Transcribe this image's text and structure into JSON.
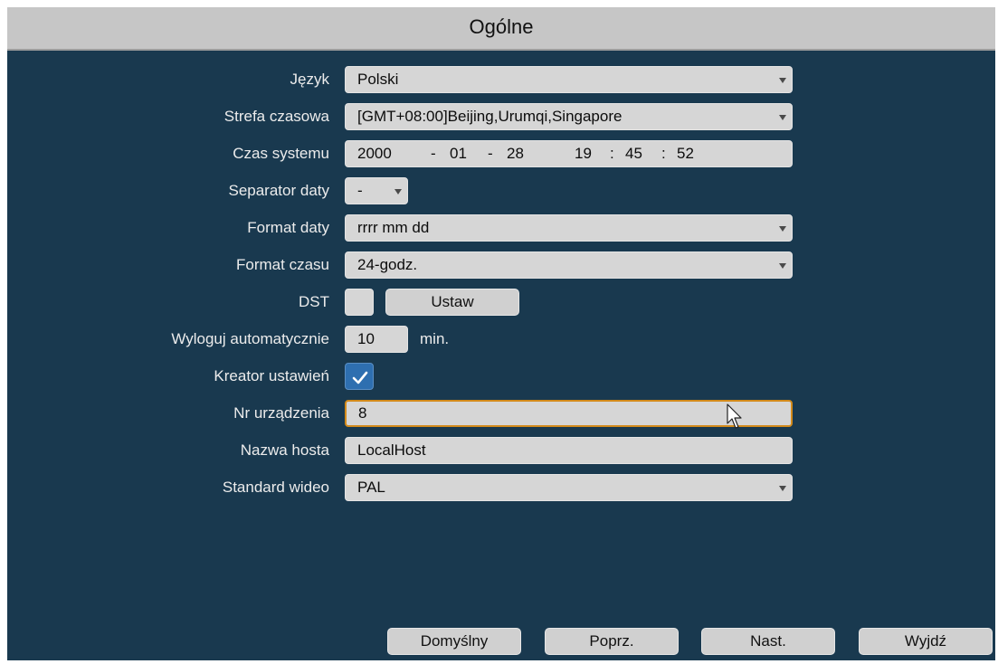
{
  "window": {
    "title": "Ogólne"
  },
  "form": {
    "language": {
      "label": "Język",
      "value": "Polski"
    },
    "timezone": {
      "label": "Strefa czasowa",
      "value": "[GMT+08:00]Beijing,Urumqi,Singapore"
    },
    "system_time": {
      "label": "Czas systemu",
      "year": "2000",
      "sep1": "-",
      "month": "01",
      "sep2": "-",
      "day": "28",
      "hour": "19",
      "colon1": ":",
      "minute": "45",
      "colon2": ":",
      "second": "52"
    },
    "date_separator": {
      "label": "Separator daty",
      "value": "-"
    },
    "date_format": {
      "label": "Format daty",
      "value": "rrrr mm dd"
    },
    "time_format": {
      "label": "Format czasu",
      "value": "24-godz."
    },
    "dst": {
      "label": "DST",
      "checked": false,
      "set_button": "Ustaw"
    },
    "auto_logout": {
      "label": "Wyloguj automatycznie",
      "value": "10",
      "unit": "min."
    },
    "setup_wizard": {
      "label": "Kreator ustawień",
      "checked": true
    },
    "device_number": {
      "label": "Nr urządzenia",
      "value": "8"
    },
    "hostname": {
      "label": "Nazwa hosta",
      "value": "LocalHost"
    },
    "video_standard": {
      "label": "Standard wideo",
      "value": "PAL"
    }
  },
  "buttons": {
    "default": "Domyślny",
    "previous": "Poprz.",
    "next": "Nast.",
    "exit": "Wyjdź"
  },
  "colors": {
    "panel": "#19394f",
    "titlebar": "#c6c6c6",
    "field": "#d6d6d6",
    "focus_border": "#d38a1a",
    "checkbox_on": "#2e6fb0"
  }
}
